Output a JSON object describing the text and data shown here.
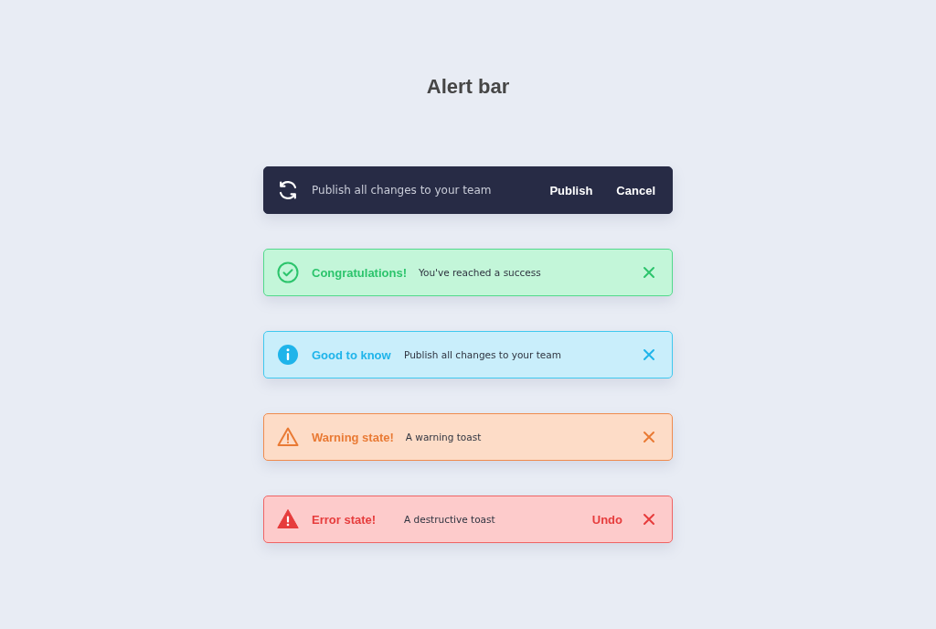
{
  "title": "Alert bar",
  "alerts": [
    {
      "kind": "neutral",
      "message": "Publish all changes to your team",
      "actions": [
        "Publish",
        "Cancel"
      ],
      "closable": false
    },
    {
      "kind": "success",
      "title": "Congratulations!",
      "message": "You've reached a success",
      "closable": true
    },
    {
      "kind": "info",
      "title": "Good to know",
      "message": "Publish all changes to your team",
      "closable": true
    },
    {
      "kind": "warning",
      "title": "Warning state!",
      "message": "A warning toast",
      "closable": true
    },
    {
      "kind": "error",
      "title": "Error state!",
      "message": "A destructive toast",
      "actions": [
        "Undo"
      ],
      "closable": true
    }
  ]
}
